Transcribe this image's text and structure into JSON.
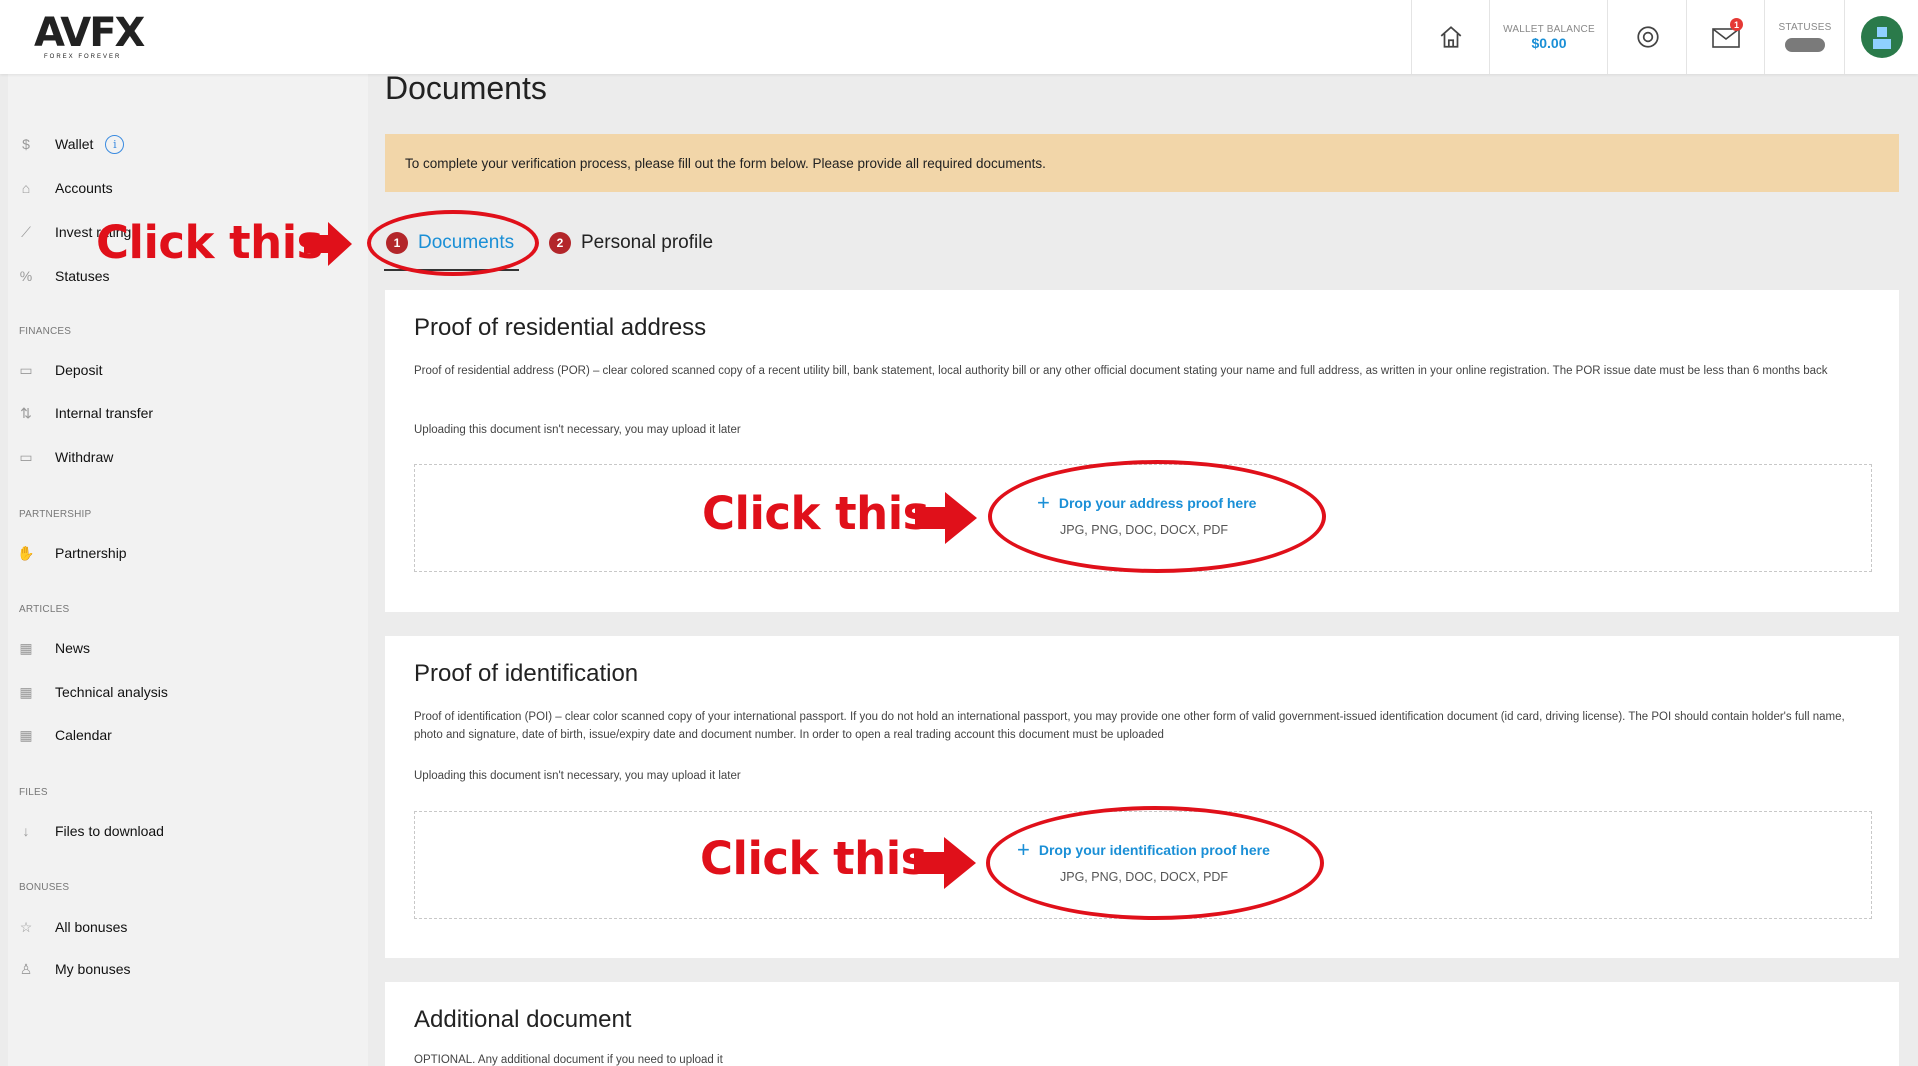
{
  "brand": {
    "logo": "AVFX",
    "tagline": "FOREX FOREVER"
  },
  "header": {
    "wallet_label": "WALLET BALANCE",
    "wallet_value": "$0.00",
    "mail_badge": "1",
    "statuses_label": "STATUSES"
  },
  "sidebar": {
    "items_top": [
      {
        "label": "Wallet",
        "icon": "dollar-icon"
      },
      {
        "label": "Accounts",
        "icon": "home-icon"
      },
      {
        "label": "Invest rating",
        "icon": "trend-icon"
      },
      {
        "label": "Statuses",
        "icon": "percent-icon"
      }
    ],
    "sections": {
      "finances": "FINANCES",
      "partnership": "PARTNERSHIP",
      "articles": "ARTICLES",
      "files": "FILES",
      "bonuses": "BONUSES"
    },
    "finances": [
      "Deposit",
      "Internal transfer",
      "Withdraw"
    ],
    "partnership": [
      "Partnership"
    ],
    "articles": [
      "News",
      "Technical analysis",
      "Calendar"
    ],
    "files": [
      "Files to download"
    ],
    "bonuses": [
      "All bonuses",
      "My bonuses"
    ]
  },
  "main": {
    "title": "Documents",
    "alert": "To complete your verification process, please fill out the form below. Please provide all required documents.",
    "tabs": [
      {
        "num": "1",
        "label": "Documents",
        "active": true
      },
      {
        "num": "2",
        "label": "Personal profile",
        "active": false
      }
    ],
    "cards": [
      {
        "title": "Proof of residential address",
        "desc": "Proof of residential address (POR) – clear colored scanned copy of a recent utility bill, bank statement, local authority bill or any other official document stating your name and full address, as written in your online registration. The POR issue date must be less than 6 months back",
        "note": "Uploading this document isn't necessary, you may upload it later",
        "drop_label": "Drop your address proof here",
        "formats": "JPG, PNG, DOC, DOCX, PDF"
      },
      {
        "title": "Proof of identification",
        "desc": "Proof of identification (POI) – clear color scanned copy of your international passport. If you do not hold an international passport, you may provide one other form of valid government-issued identification document (id card, driving license). The POI should contain holder's full name, photo and signature, date of birth, issue/expiry date and document number. In order to open a real trading account this document must be uploaded",
        "note": "Uploading this document isn't necessary, you may upload it later",
        "drop_label": "Drop your identification proof here",
        "formats": "JPG, PNG, DOC, DOCX, PDF"
      },
      {
        "title": "Additional document",
        "desc": "OPTIONAL. Any additional document if you need to upload it"
      }
    ]
  },
  "annotations": {
    "click": "Click this",
    "color": "#e0101a"
  }
}
